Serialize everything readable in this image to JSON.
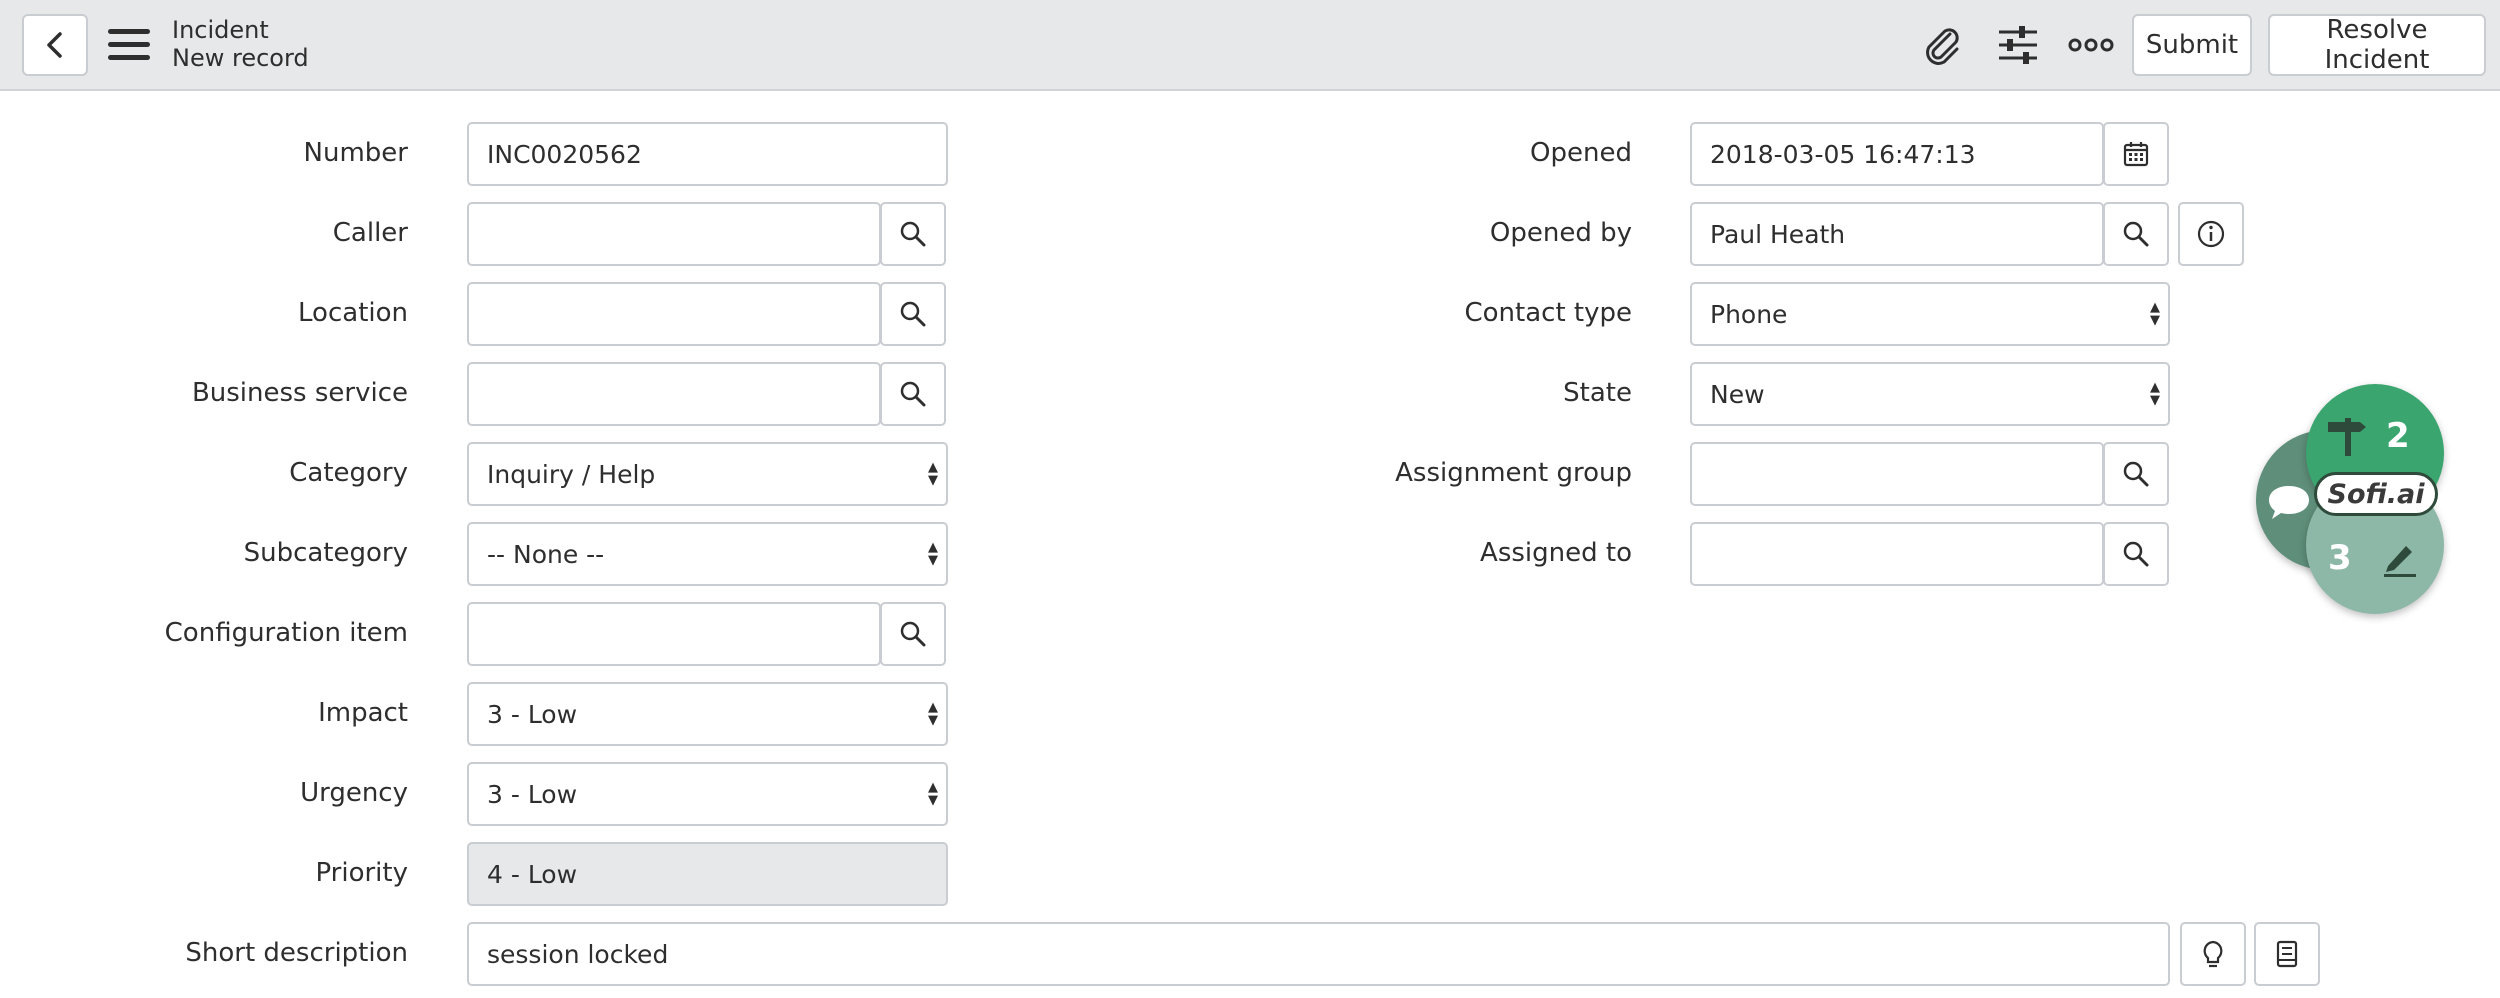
{
  "header": {
    "title": "Incident",
    "subtitle": "New record",
    "submit_label": "Submit",
    "resolve_label": "Resolve Incident",
    "icons": [
      "back-icon",
      "menu-icon",
      "attachment-icon",
      "settings-sliders-icon",
      "more-options-icon"
    ]
  },
  "form": {
    "number": {
      "label": "Number",
      "value": "INC0020562"
    },
    "caller": {
      "label": "Caller",
      "value": ""
    },
    "location": {
      "label": "Location",
      "value": ""
    },
    "business_service": {
      "label": "Business service",
      "value": ""
    },
    "category": {
      "label": "Category",
      "value": "Inquiry / Help"
    },
    "subcategory": {
      "label": "Subcategory",
      "value": "-- None --"
    },
    "configuration_item": {
      "label": "Configuration item",
      "value": ""
    },
    "impact": {
      "label": "Impact",
      "value": "3 - Low"
    },
    "urgency": {
      "label": "Urgency",
      "value": "3 - Low"
    },
    "priority": {
      "label": "Priority",
      "value": "4 - Low"
    },
    "short_description": {
      "label": "Short description",
      "value": "session locked"
    },
    "opened": {
      "label": "Opened",
      "value": "2018-03-05 16:47:13"
    },
    "opened_by": {
      "label": "Opened by",
      "value": "Paul Heath"
    },
    "contact_type": {
      "label": "Contact type",
      "value": "Phone"
    },
    "state": {
      "label": "State",
      "value": "New"
    },
    "assignment_group": {
      "label": "Assignment group",
      "value": ""
    },
    "assigned_to": {
      "label": "Assigned to",
      "value": ""
    }
  },
  "sofi": {
    "brand": "Sofi.ai",
    "top_count": "2",
    "bottom_count": "3",
    "colors": {
      "top": "#3aa56e",
      "bottom": "#8db8a8",
      "side": "#5f8f7b"
    }
  },
  "colors": {
    "header_bg": "#e6e8ea",
    "border": "#c9cdd1",
    "readonly_bg": "#e6e8ea",
    "text": "#2e2e2e"
  }
}
